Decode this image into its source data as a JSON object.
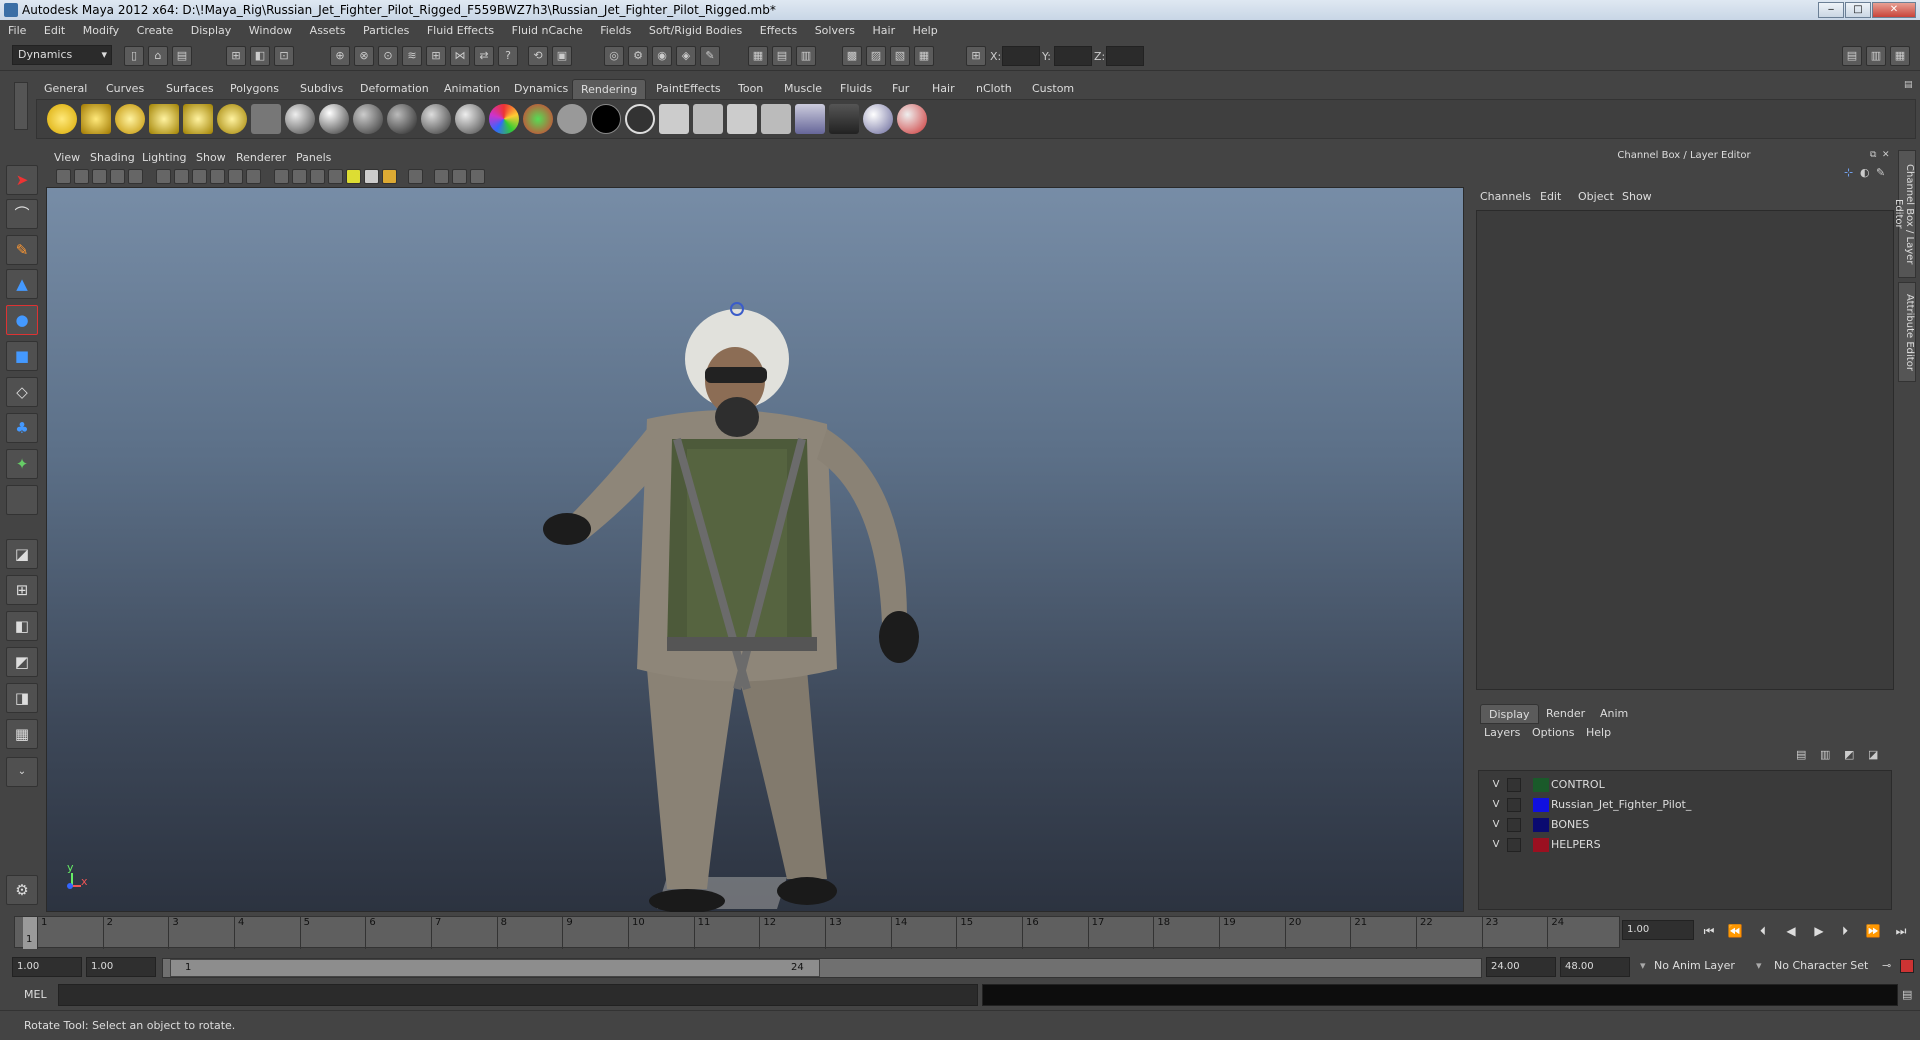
{
  "window": {
    "title": "Autodesk Maya 2012 x64: D:\\!Maya_Rig\\Russian_Jet_Fighter_Pilot_Rigged_F559BWZ7h3\\Russian_Jet_Fighter_Pilot_Rigged.mb*",
    "min": "‒",
    "max": "□",
    "close": "✕"
  },
  "menubar": [
    "File",
    "Edit",
    "Modify",
    "Create",
    "Display",
    "Window",
    "Assets",
    "Particles",
    "Fluid Effects",
    "Fluid nCache",
    "Fields",
    "Soft/Rigid Bodies",
    "Effects",
    "Solvers",
    "Hair",
    "Help"
  ],
  "statusline": {
    "menuset": "Dynamics",
    "x_label": "X:",
    "y_label": "Y:",
    "z_label": "Z:"
  },
  "shelf": {
    "tabs": [
      "General",
      "Curves",
      "Surfaces",
      "Polygons",
      "Subdivs",
      "Deformation",
      "Animation",
      "Dynamics",
      "Rendering",
      "PaintEffects",
      "Toon",
      "Muscle",
      "Fluids",
      "Fur",
      "Hair",
      "nCloth",
      "Custom"
    ],
    "active_tab": "Rendering"
  },
  "viewport": {
    "menus": [
      "View",
      "Shading",
      "Lighting",
      "Show",
      "Renderer",
      "Panels"
    ],
    "axis_y": "y",
    "axis_x": "x"
  },
  "channelbox": {
    "title": "Channel Box / Layer Editor",
    "menus": [
      "Channels",
      "Edit",
      "Object",
      "Show"
    ],
    "side_tabs": [
      "Channel Box / Layer Editor",
      "Attribute Editor"
    ]
  },
  "layers": {
    "tabs": [
      "Display",
      "Render",
      "Anim"
    ],
    "active_tab": "Display",
    "menus": [
      "Layers",
      "Options",
      "Help"
    ],
    "items": [
      {
        "visible": "V",
        "name": "CONTROL",
        "color": "#1a5a2a"
      },
      {
        "visible": "V",
        "name": "Russian_Jet_Fighter_Pilot_",
        "color": "#1010e0"
      },
      {
        "visible": "V",
        "name": "BONES",
        "color": "#0a0a70"
      },
      {
        "visible": "V",
        "name": "HELPERS",
        "color": "#9a1020"
      }
    ]
  },
  "timeslider": {
    "ticks": [
      "1",
      "2",
      "3",
      "4",
      "5",
      "6",
      "7",
      "8",
      "9",
      "10",
      "11",
      "12",
      "13",
      "14",
      "15",
      "16",
      "17",
      "18",
      "19",
      "20",
      "21",
      "22",
      "23",
      "24"
    ],
    "current_marker": "1",
    "current_time": "1.00"
  },
  "range": {
    "start_time": "1.00",
    "playback_start": "1.00",
    "range_start_label": "1",
    "range_end_label": "24",
    "playback_end": "24.00",
    "end_time": "48.00",
    "anim_layer": "No Anim Layer",
    "character_set": "No Character Set"
  },
  "command": {
    "label": "MEL"
  },
  "helpline": "Rotate Tool: Select an object to rotate."
}
